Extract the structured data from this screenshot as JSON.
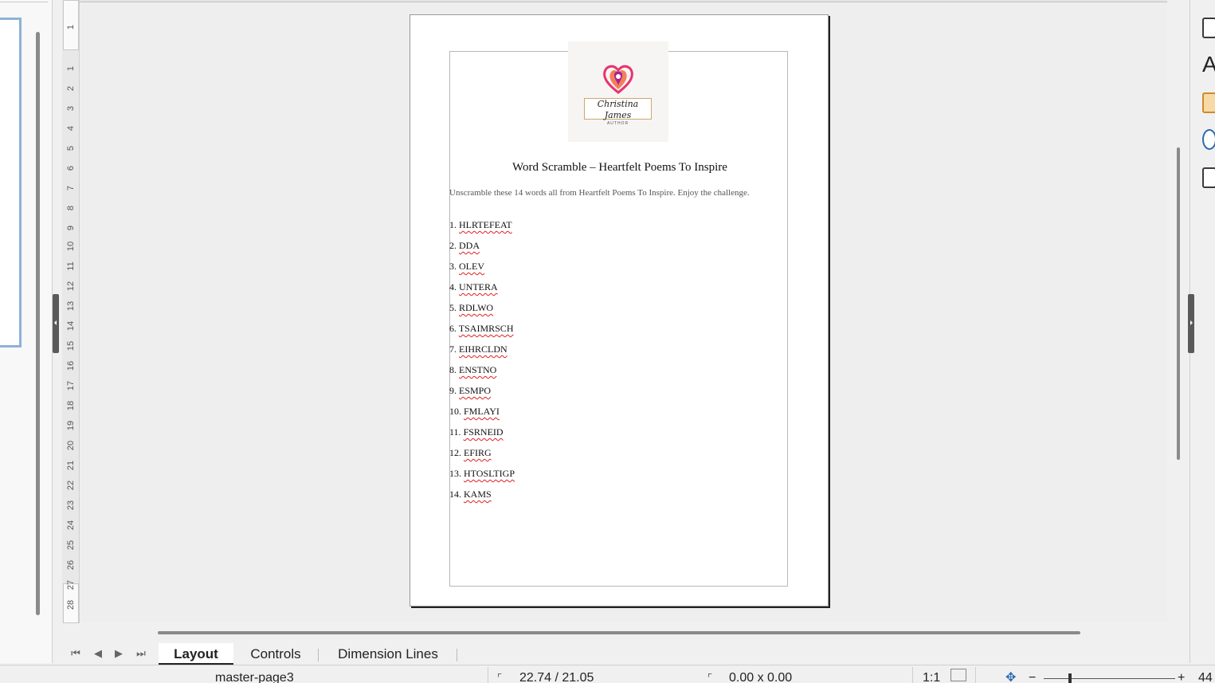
{
  "app": {
    "accent_color": "#8db2d6"
  },
  "vertical_ruler": {
    "labels": [
      "1",
      "1",
      "2",
      "3",
      "4",
      "5",
      "6",
      "7",
      "8",
      "9",
      "10",
      "11",
      "12",
      "13",
      "14",
      "15",
      "16",
      "17",
      "18",
      "19",
      "20",
      "21",
      "22",
      "23",
      "24",
      "25",
      "26",
      "27",
      "28"
    ]
  },
  "document": {
    "logo": {
      "name": "Christina James",
      "sub": "AUTHOR"
    },
    "title": "Word Scramble – Heartfelt Poems To Inspire",
    "subtitle": "Unscramble these 14 words all from Heartfelt Poems To Inspire. Enjoy the challenge.",
    "words": [
      {
        "num": "1.",
        "word": "HLRTEFEAT"
      },
      {
        "num": "2.",
        "word": "DDA"
      },
      {
        "num": "3.",
        "word": "OLEV"
      },
      {
        "num": "4.",
        "word": "UNTERA"
      },
      {
        "num": "5.",
        "word": "RDLWO"
      },
      {
        "num": "6.",
        "word": "TSAIMRSCH"
      },
      {
        "num": "7.",
        "word": "EIHRCLDN"
      },
      {
        "num": "8.",
        "word": "ENSTNO"
      },
      {
        "num": "9.",
        "word": "ESMPO"
      },
      {
        "num": "10.",
        "word": "FMLAYI"
      },
      {
        "num": "11.",
        "word": "FSRNEID"
      },
      {
        "num": "12.",
        "word": "EFIRG"
      },
      {
        "num": "13.",
        "word": "HTOSLTIGP"
      },
      {
        "num": "14.",
        "word": "KAMS"
      }
    ]
  },
  "tabs": {
    "layout": "Layout",
    "controls": "Controls",
    "dimension_lines": "Dimension Lines"
  },
  "status": {
    "master_page": "master-page3",
    "position": "22.74 / 21.05",
    "size": "0.00 x 0.00",
    "scale": "1:1",
    "zoom": "44"
  },
  "sidebar_icons": [
    "properties-icon",
    "styles-icon",
    "gallery-icon",
    "navigator-icon",
    "shapes-icon"
  ]
}
